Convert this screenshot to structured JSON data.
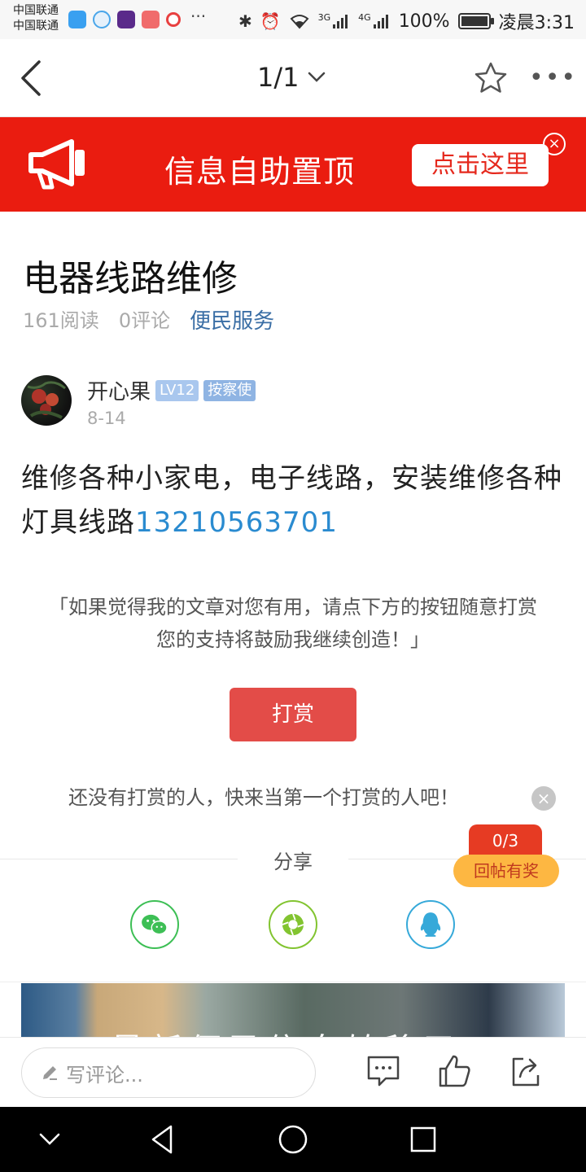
{
  "status_bar": {
    "carrier_1": "中国联通",
    "carrier_2": "中国联通",
    "more_dots": "···",
    "network_3g": "3G",
    "network_4g": "4G",
    "battery": "100%",
    "time": "凌晨3:31"
  },
  "nav": {
    "page_indicator": "1/1"
  },
  "banner": {
    "text": "信息自助置顶",
    "button": "点击这里",
    "close": "×"
  },
  "article": {
    "title": "电器线路维修",
    "reads": "161阅读",
    "comments": "0评论",
    "category": "便民服务",
    "author": "开心果",
    "level": "LV12",
    "role": "按察使",
    "date": "8-14",
    "body": "维修各种小家电，电子线路，安装维修各种灯具线路",
    "phone": "13210563701"
  },
  "reward": {
    "prompt_line1": "「如果觉得我的文章对您有用，请点下方的按钮随意打赏",
    "prompt_line2": "您的支持将鼓励我继续创造！」",
    "button": "打赏",
    "empty": "还没有打赏的人，快来当第一个打赏的人吧！"
  },
  "floating": {
    "progress": "0/3",
    "label": "回帖有奖",
    "close": "×"
  },
  "share": {
    "label": "分享"
  },
  "ad": {
    "text": "最新便民信息转移了！"
  },
  "comment_bar": {
    "placeholder": "写评论..."
  },
  "colors": {
    "banner_red": "#ea1c10",
    "reward_red": "#e34c48",
    "link_blue": "#2a8bd0",
    "category_blue": "#3a6ea5"
  }
}
